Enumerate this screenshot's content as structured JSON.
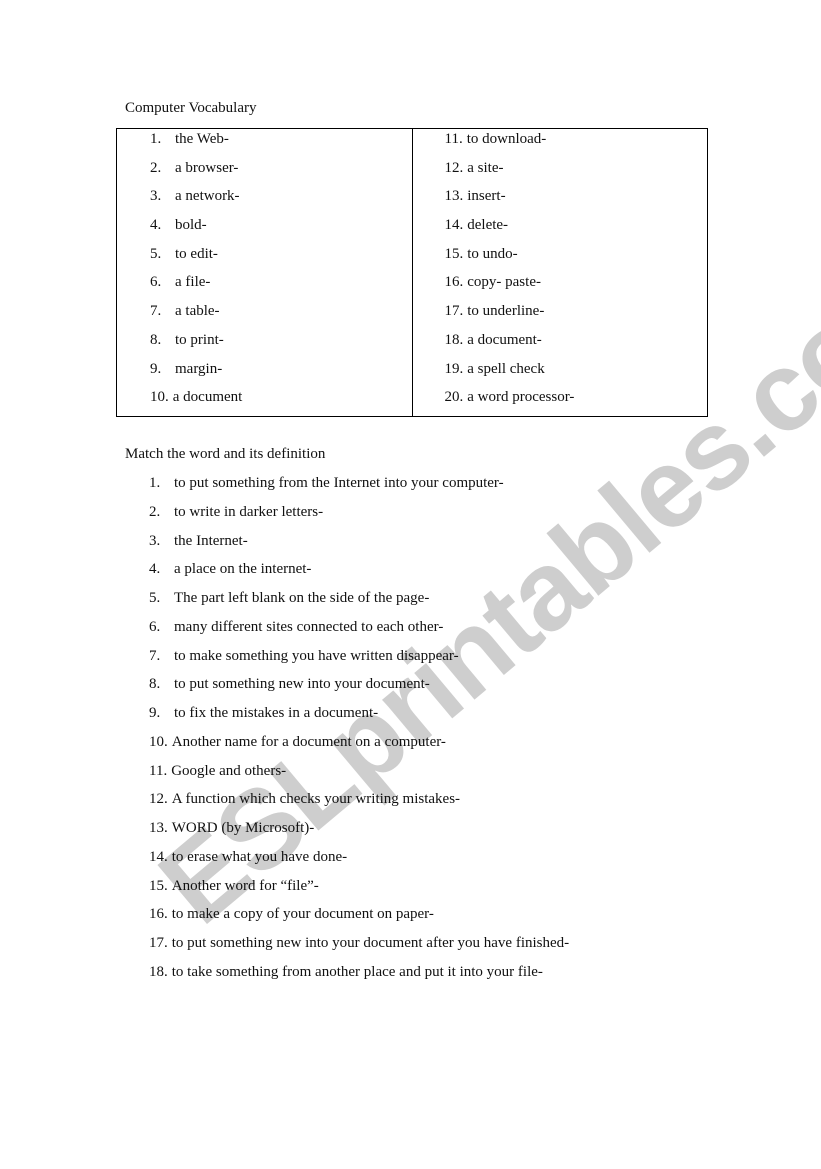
{
  "document": {
    "title": "Computer Vocabulary",
    "vocabulary": {
      "left_column": [
        {
          "num": "1.",
          "term": "the Web-"
        },
        {
          "num": "2.",
          "term": "a browser-"
        },
        {
          "num": "3.",
          "term": "a network-"
        },
        {
          "num": "4.",
          "term": "bold-"
        },
        {
          "num": "5.",
          "term": "to edit-"
        },
        {
          "num": "6.",
          "term": "a file-"
        },
        {
          "num": "7.",
          "term": "a table-"
        },
        {
          "num": "8.",
          "term": "to print-"
        },
        {
          "num": "9.",
          "term": "margin-"
        },
        {
          "num": "10.",
          "term": "a document"
        }
      ],
      "right_column": [
        {
          "num": "11.",
          "term": "to download-"
        },
        {
          "num": "12.",
          "term": "a site-"
        },
        {
          "num": "13.",
          "term": "insert-"
        },
        {
          "num": "14.",
          "term": "delete-"
        },
        {
          "num": "15.",
          "term": "to undo-"
        },
        {
          "num": "16.",
          "term": "copy- paste-"
        },
        {
          "num": "17.",
          "term": "to underline-"
        },
        {
          "num": "18.",
          "term": "a document-"
        },
        {
          "num": "19.",
          "term": "a spell check"
        },
        {
          "num": "20.",
          "term": "a word processor-"
        }
      ]
    },
    "matching": {
      "title": "Match the word and its definition",
      "definitions": [
        {
          "num": "1.",
          "text": "to put something from the Internet into your computer-"
        },
        {
          "num": "2.",
          "text": "to write in darker letters-"
        },
        {
          "num": "3.",
          "text": "the Internet-"
        },
        {
          "num": "4.",
          "text": "a place on the internet-"
        },
        {
          "num": "5.",
          "text": "The part left blank on the side of the page-"
        },
        {
          "num": "6.",
          "text": "many different sites connected to each other-"
        },
        {
          "num": "7.",
          "text": "to make something you have written disappear-"
        },
        {
          "num": "8.",
          "text": "to put something new into your document-"
        },
        {
          "num": "9.",
          "text": "to fix the mistakes in a document-"
        },
        {
          "num": "10.",
          "text": "Another name for a document on a computer-"
        },
        {
          "num": "11.",
          "text": "Google and others-"
        },
        {
          "num": "12.",
          "text": "A function which checks your writing mistakes-"
        },
        {
          "num": "13.",
          "text": "WORD (by Microsoft)-"
        },
        {
          "num": "14.",
          "text": "to erase what you have done-"
        },
        {
          "num": "15.",
          "text": "Another word for “file”-"
        },
        {
          "num": "16.",
          "text": "to make a copy of your document on paper-"
        },
        {
          "num": "17.",
          "text": "to put something new into your document after you have finished-"
        },
        {
          "num": "18.",
          "text": "to take something from another place and put it into your file-"
        }
      ]
    }
  },
  "watermark": {
    "text": "ESLprintables.com",
    "color": "#c9c9c9"
  }
}
